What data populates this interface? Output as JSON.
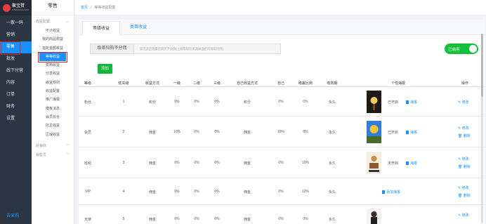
{
  "app": {
    "logo_text": "聚宝赞",
    "logo_sub": "JUBAOZAN.COM",
    "bottom_link": "去采购"
  },
  "nav": [
    {
      "label": "一散一码"
    },
    {
      "label": "营销"
    },
    {
      "label": "零售"
    },
    {
      "label": "批发"
    },
    {
      "label": "线下付营"
    },
    {
      "label": "内容"
    },
    {
      "label": "订单"
    },
    {
      "label": "财务"
    },
    {
      "label": "设置"
    }
  ],
  "subnav": {
    "title": "零售",
    "group1": "收益配置",
    "items": [
      "不计收益",
      "我的商品收益",
      "指定金额收益",
      "等等收益",
      "复购收益",
      "分享收益",
      "收益规则",
      "收益配置",
      "推广海报",
      "模板消息",
      "会员云仓",
      "店主收益",
      "区域收益"
    ],
    "group2": "经销商",
    "group3": "销售员"
  },
  "breadcrumb": {
    "home": "首页",
    "sep": "/",
    "current": "等等收益配置"
  },
  "tabs": [
    "等级收益",
    "类目收益"
  ],
  "filter": {
    "label": "级差归购不分佣",
    "hint": "该选开启则最后购买不分佣(上级等级比例减掉自己的等级比例)"
  },
  "toggle": {
    "label": "已启用"
  },
  "add_button": "添加",
  "table": {
    "headers": [
      "等级",
      "优先级",
      "收益方式",
      "一级",
      "二级",
      "三级",
      "自己收益方式",
      "自己",
      "级差比例",
      "有效期",
      "个性海报",
      "操作"
    ],
    "rows": [
      {
        "level": "粉丝",
        "priority": "1",
        "method": "积分",
        "l1": "0%",
        "l2": "0%",
        "l3": "0%",
        "self_method": "积分",
        "self": "0%",
        "diff": "0%",
        "valid": "永久",
        "poster_status": "已开启",
        "poster_link": "海报",
        "ops": [
          "修改"
        ]
      },
      {
        "level": "会员",
        "priority": "2",
        "method": "佣金",
        "l1": "10%",
        "l2": "0%",
        "l3": "0%",
        "self_method": "佣金",
        "self": "10%",
        "diff": "8%",
        "valid": "永久",
        "poster_status": "已开启",
        "poster_link": "海报",
        "ops": [
          "修改",
          "删除"
        ]
      },
      {
        "level": "班组",
        "priority": "3",
        "method": "佣金",
        "l1": "0%",
        "l2": "0%",
        "l3": "0%",
        "self_method": "佣金",
        "self": "0%",
        "diff": "10%",
        "valid": "永久",
        "poster_status": "未开启",
        "poster_link": "海报",
        "ops": [
          "修改",
          "删除"
        ]
      },
      {
        "level": "VIP",
        "priority": "4",
        "method": "佣金",
        "l1": "0%",
        "l2": "0%",
        "l3": "0%",
        "self_method": "佣金",
        "self": "0%",
        "diff": "12%",
        "valid": "永久",
        "poster_status": "",
        "poster_link": "添加海报",
        "ops": [
          "修改",
          "删除"
        ]
      },
      {
        "level": "天使",
        "priority": "5",
        "method": "佣金",
        "l1": "0%",
        "l2": "0%",
        "l3": "0%",
        "self_method": "佣金",
        "self": "0%",
        "diff": "0%",
        "valid": "永久",
        "poster_status": "",
        "poster_link": "",
        "ops": [
          "修改"
        ]
      }
    ]
  },
  "colors": {
    "accent": "#1890ff",
    "nav_bg": "#2c3642",
    "toggle": "#13c23a",
    "highlight_border": "#e02020"
  }
}
